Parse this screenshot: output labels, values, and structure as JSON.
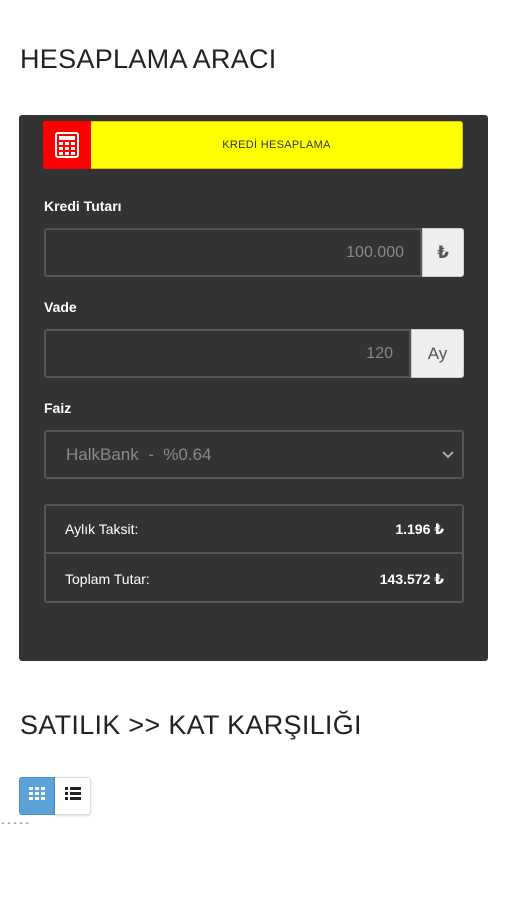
{
  "headings": {
    "calculator_title": "HESAPLAMA ARACI",
    "listing_title": "SATILIK >> KAT KARŞILIĞI"
  },
  "calculator": {
    "banner_label": "KREDİ HESAPLAMA",
    "banner_icon": "calculator-icon",
    "loan_amount": {
      "label": "Kredi Tutarı",
      "value": "100.000",
      "addon": "₺"
    },
    "term": {
      "label": "Vade",
      "value": "120",
      "addon": "Ay"
    },
    "interest": {
      "label": "Faiz",
      "selected": "HalkBank  -  %0.64"
    },
    "results": [
      {
        "label": "Aylık Taksit:",
        "value": "1.196 ₺"
      },
      {
        "label": "Toplam Tutar:",
        "value": "143.572 ₺"
      }
    ]
  },
  "view_toggle": {
    "grid_icon": "grid-view-icon",
    "list_icon": "list-view-icon"
  },
  "dashes": "-----",
  "colors": {
    "panel_bg": "#333333",
    "banner_bg": "#ffff00",
    "banner_icon_bg": "#ff0000",
    "toggle_active": "#5aa2d7"
  }
}
